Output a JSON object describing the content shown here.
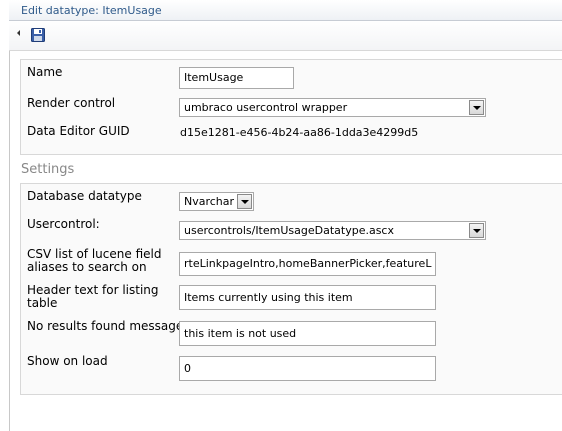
{
  "title": "Edit datatype: ItemUsage",
  "toolbar": {
    "back_icon": "left-arrow-icon",
    "save_icon": "floppy-disk-icon"
  },
  "properties": {
    "name_label": "Name",
    "name_value": "ItemUsage",
    "render_control_label": "Render control",
    "render_control_value": "umbraco usercontrol wrapper",
    "guid_label": "Data Editor GUID",
    "guid_value": "d15e1281-e456-4b24-aa86-1dda3e4299d5"
  },
  "settings": {
    "heading": "Settings",
    "db_datatype_label": "Database datatype",
    "db_datatype_value": "Nvarchar",
    "usercontrol_label": "Usercontrol:",
    "usercontrol_value": "usercontrols/ItemUsageDatatype.ascx",
    "csv_label_line1": "CSV list of lucene field",
    "csv_label_line2": "aliases to search on",
    "csv_value": "rteLinkpageIntro,homeBannerPicker,featureL",
    "header_label_line1": "Header text for listing",
    "header_label_line2": "table",
    "header_value": "Items currently using this item",
    "noresults_label": "No results found message",
    "noresults_value": "this item is not used",
    "showonload_label": "Show on load",
    "showonload_value": "0"
  }
}
